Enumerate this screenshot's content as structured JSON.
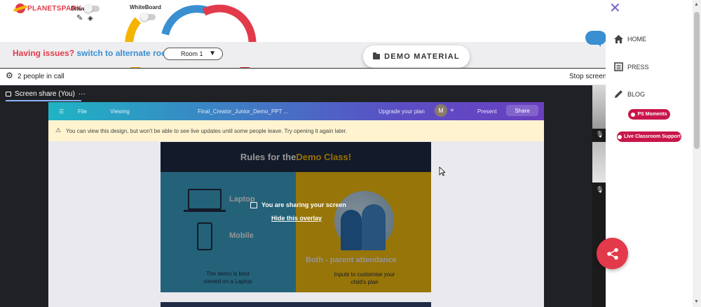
{
  "brand": {
    "logo_text": "PLANETSPARK"
  },
  "tools": {
    "draw_label": "Draw",
    "whiteboard_label": "WhiteBoard"
  },
  "issue_bar": {
    "question": "Having issues?",
    "link": "switch to alternate room",
    "room_value": "Room 1",
    "demo_material_label": "DEMO MATERIAL"
  },
  "call": {
    "people_count": "2 people in call",
    "stop_sharing_label": "Stop screen",
    "share_tab_label": "Screen share (You)",
    "more_icon": "···"
  },
  "shared_screen": {
    "menu_file": "File",
    "menu_viewing": "Viewing",
    "doc_title": "Final_Creator_Junior_Demo_PPT ...",
    "upgrade_label": "Upgrade your plan",
    "avatar_initial": "M",
    "present_label": "Present",
    "share_label": "Share",
    "warning_text": "You can view this design, but won't be able to see live updates until some people leave. Try opening it again later.",
    "slide": {
      "title_part1": "Rules for the ",
      "title_part2": "Demo Class!",
      "laptop_label": "Laptop",
      "mobile_label": "Mobile",
      "left_note_line1": "The demo is best",
      "left_note_line2": "viewed on a Laptop",
      "right_title": "Both - parent attendance",
      "right_note_line1": "Inputs to customise your",
      "right_note_line2": "child's plan"
    },
    "overlay_title": "You are sharing your screen",
    "overlay_link": "Hide this overlay"
  },
  "menu": {
    "items": [
      {
        "label": "HOME",
        "icon": "home-icon"
      },
      {
        "label": "PRESS",
        "icon": "newspaper-icon"
      },
      {
        "label": "BLOG",
        "icon": "pencil-icon"
      }
    ],
    "ps_moments_label": "PS Moments",
    "live_support_label": "Live Classroom Support"
  },
  "colors": {
    "brand_red": "#e23a4a",
    "link_blue": "#3a8fd0",
    "pill_red": "#c8164a",
    "meet_dark": "#202124"
  }
}
